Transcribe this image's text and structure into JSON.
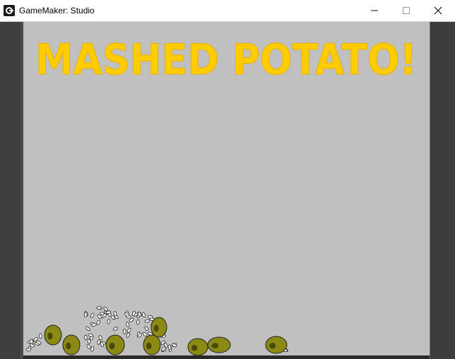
{
  "window": {
    "title": "GameMaker: Studio",
    "minimize_icon": "minimize-icon",
    "maximize_icon": "maximize-icon",
    "close_icon": "close-icon",
    "app_icon": "gamemaker-icon"
  },
  "game": {
    "title_text": "MASHED POTATO!",
    "title_color": "#ffcc00",
    "background_color": "#c0c0c0",
    "potato_fill": "#8a8a14",
    "potato_dark": "#4a4a0a"
  }
}
